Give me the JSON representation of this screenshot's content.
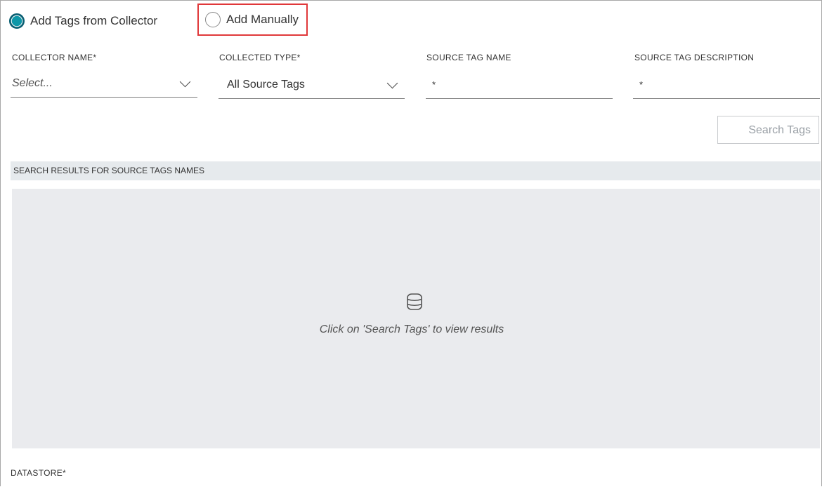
{
  "mode_options": {
    "from_collector": {
      "label": "Add Tags from Collector",
      "checked": true
    },
    "manual": {
      "label": "Add Manually",
      "checked": false,
      "highlighted": true
    }
  },
  "filters": {
    "collector_name": {
      "label": "COLLECTOR NAME*",
      "placeholder": "Select..."
    },
    "collected_type": {
      "label": "COLLECTED TYPE*",
      "value": "All Source Tags"
    },
    "source_tag_name": {
      "label": "SOURCE TAG NAME",
      "value": "*"
    },
    "source_tag_description": {
      "label": "SOURCE TAG DESCRIPTION",
      "value": "*"
    }
  },
  "search_button": {
    "label": "Search Tags"
  },
  "results": {
    "header": "SEARCH RESULTS FOR SOURCE TAGS NAMES",
    "empty_icon": "database-icon",
    "empty_message": "Click on 'Search Tags' to view results"
  },
  "datastore": {
    "label": "DATASTORE*"
  },
  "colors": {
    "accent": "#0e97a8",
    "highlight_border": "#e0383a",
    "results_background": "#eaebee"
  }
}
